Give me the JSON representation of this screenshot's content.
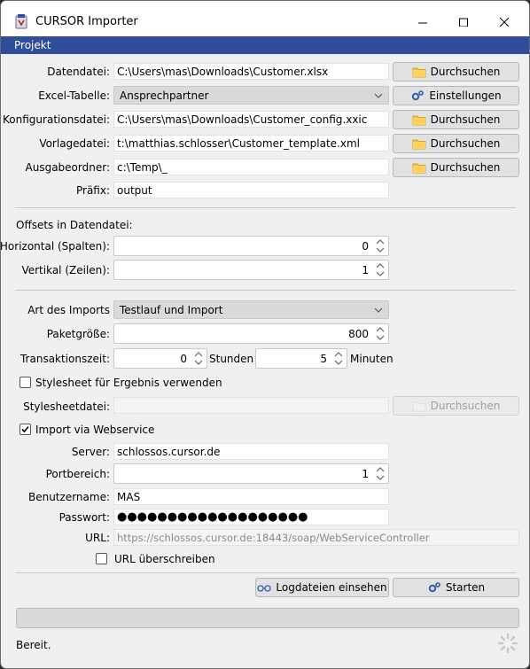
{
  "window": {
    "title": "CURSOR Importer"
  },
  "menu": {
    "project": "Projekt"
  },
  "files": {
    "data_file_label": "Datendatei:",
    "data_file_value": "C:\\Users\\mas\\Downloads\\Customer.xlsx",
    "excel_table_label": "Excel-Tabelle:",
    "excel_table_value": "Ansprechpartner",
    "config_file_label": "Konfigurationsdatei:",
    "config_file_value": "C:\\Users\\mas\\Downloads\\Customer_config.xxic",
    "template_file_label": "Vorlagedatei:",
    "template_file_value": "t:\\matthias.schlosser\\Customer_template.xml",
    "output_folder_label": "Ausgabeordner:",
    "output_folder_value": "c:\\Temp\\_",
    "prefix_label": "Präfix:",
    "prefix_value": "output",
    "browse_label": "Durchsuchen",
    "settings_label": "Einstellungen"
  },
  "offsets": {
    "heading": "Offsets in Datendatei:",
    "horizontal_label": "Horizontal (Spalten):",
    "horizontal_value": "0",
    "vertical_label": "Vertikal (Zeilen):",
    "vertical_value": "1"
  },
  "import": {
    "type_label": "Art des Imports",
    "type_value": "Testlauf und Import",
    "package_size_label": "Paketgröße:",
    "package_size_value": "800",
    "transaction_time_label": "Transaktionszeit:",
    "hours_value": "0",
    "hours_label": "Stunden",
    "minutes_value": "5",
    "minutes_label": "Minuten",
    "stylesheet_checkbox_label": "Stylesheet für Ergebnis verwenden",
    "stylesheet_checked": false,
    "stylesheet_file_label": "Stylesheetdatei:",
    "stylesheet_file_value": "",
    "stylesheet_browse_label": "Durchsuchen"
  },
  "webservice": {
    "checkbox_label": "Import via Webservice",
    "checked": true,
    "server_label": "Server:",
    "server_value": "schlossos.cursor.de",
    "port_label": "Portbereich:",
    "port_value": "1",
    "username_label": "Benutzername:",
    "username_value": "MAS",
    "password_label": "Passwort:",
    "password_value": "●●●●●●●●●●●●●●●●●●●",
    "url_label": "URL:",
    "url_value": "https://schlossos.cursor.de:18443/soap/WebServiceController",
    "override_url_label": "URL überschreiben",
    "override_url_checked": false
  },
  "actions": {
    "logs_label": "Logdateien einsehen",
    "start_label": "Starten"
  },
  "status": {
    "text": "Bereit.",
    "progress": 0
  },
  "colors": {
    "menubar": "#2f4d9a",
    "window_bg": "#f0f0f0"
  }
}
